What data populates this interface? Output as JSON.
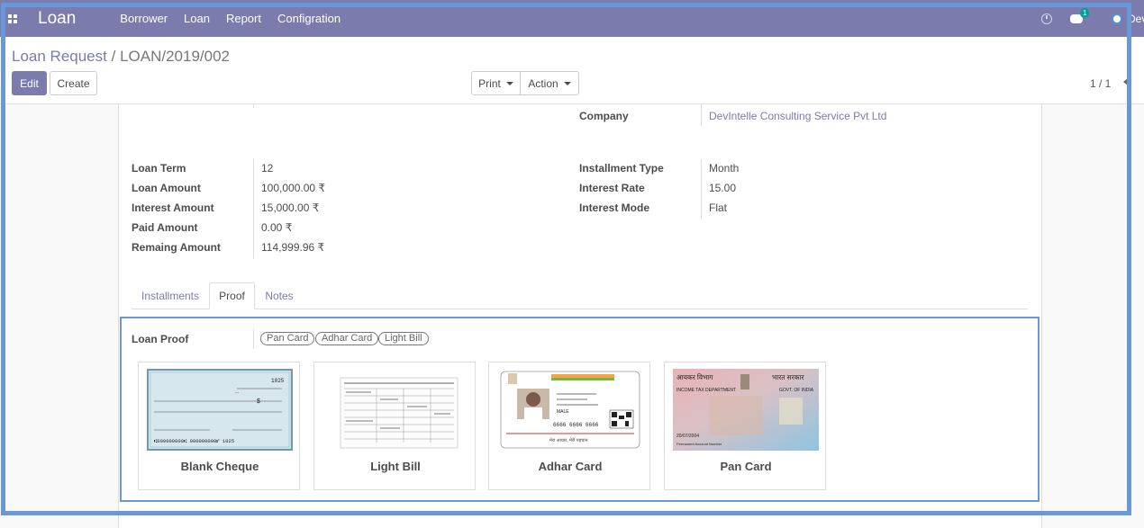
{
  "navbar": {
    "brand": "Loan",
    "menu": [
      "Borrower",
      "Loan",
      "Report",
      "Configration"
    ],
    "chat_badge": "1",
    "user": "Devi"
  },
  "breadcrumb": {
    "parent": "Loan Request",
    "separator": "/",
    "current": "LOAN/2019/002"
  },
  "buttons": {
    "edit": "Edit",
    "create": "Create",
    "print": "Print",
    "action": "Action"
  },
  "pager": "1 / 1",
  "form": {
    "company_label": "Company",
    "company_value": "DevIntelle Consulting Service Pvt Ltd",
    "left": [
      {
        "label": "Loan Term",
        "value": "12"
      },
      {
        "label": "Loan Amount",
        "value": "100,000.00 ₹"
      },
      {
        "label": "Interest Amount",
        "value": "15,000.00 ₹"
      },
      {
        "label": "Paid Amount",
        "value": "0.00 ₹"
      },
      {
        "label": "Remaing Amount",
        "value": "114,999.96 ₹"
      }
    ],
    "right": [
      {
        "label": "Installment Type",
        "value": "Month"
      },
      {
        "label": "Interest Rate",
        "value": "15.00"
      },
      {
        "label": "Interest Mode",
        "value": "Flat"
      }
    ]
  },
  "tabs": [
    "Installments",
    "Proof",
    "Notes"
  ],
  "proof": {
    "label": "Loan Proof",
    "tags": [
      "Pan Card",
      "Adhar Card",
      "Light Bill"
    ],
    "cards": [
      {
        "caption": "Blank Cheque",
        "cheque_no": "1025",
        "micr": "⑆000000000⑆ 000000000⑈ 1025"
      },
      {
        "caption": "Light Bill"
      },
      {
        "caption": "Adhar Card",
        "number": "6666 6666 6666",
        "gender": "MALE",
        "footer": "मेरा आधार, मेरी पहचान"
      },
      {
        "caption": "Pan Card",
        "hindi_dept": "आयकर विभाग",
        "hindi_govt": "भारत सरकार",
        "dept": "INCOME TAX DEPARTMENT",
        "govt": "GOVT. OF INDIA",
        "date": "20/07/2004",
        "pan_label": "Permanent Account Number"
      }
    ]
  }
}
